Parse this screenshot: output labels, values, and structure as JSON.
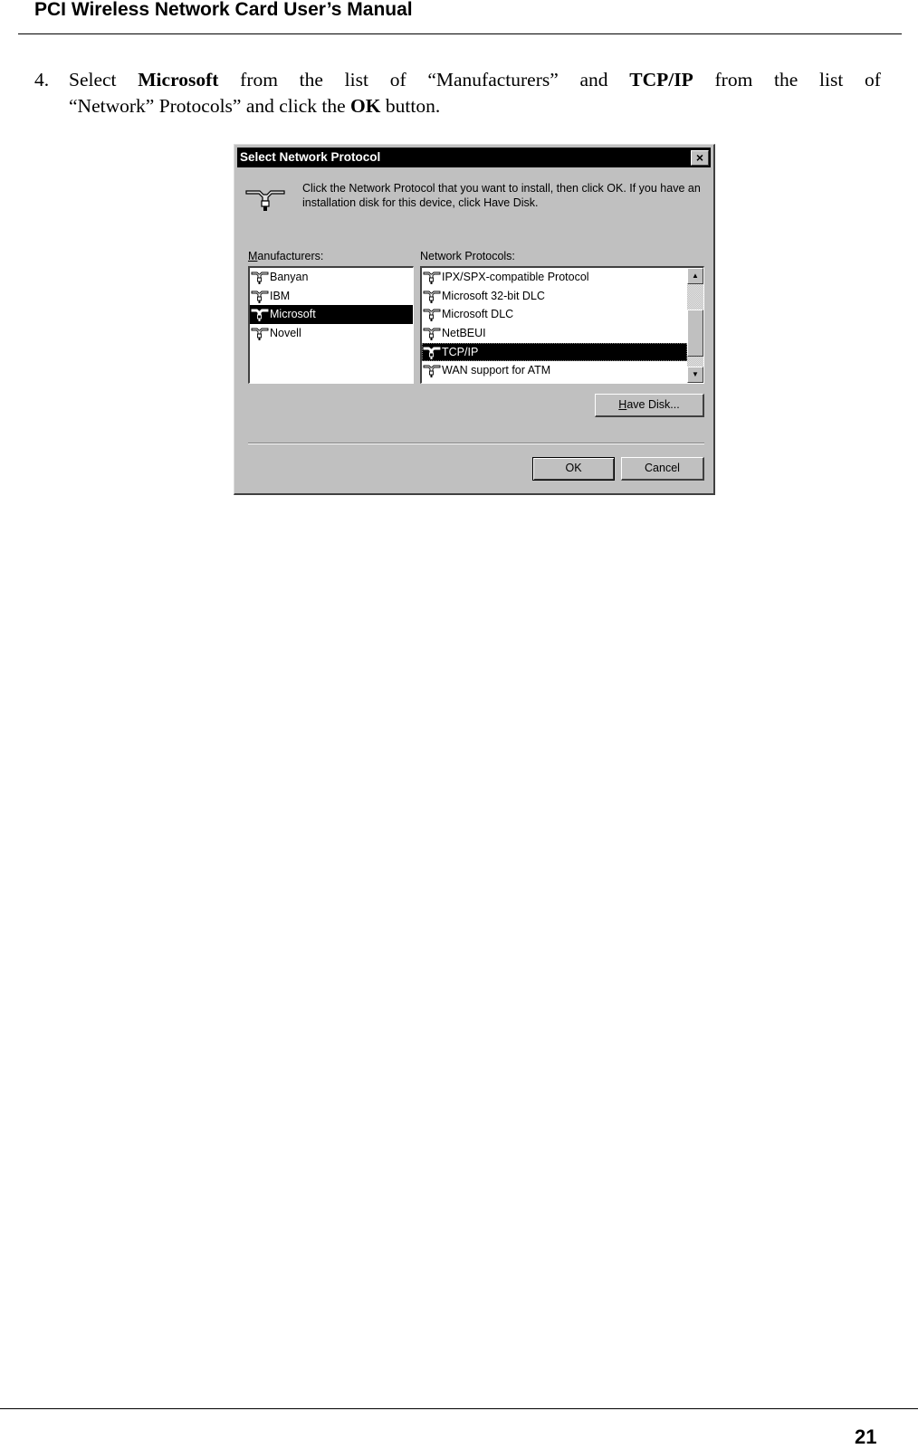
{
  "header": {
    "title": "PCI Wireless Network Card User’s Manual"
  },
  "step": {
    "number": "4.",
    "line1_parts": [
      "Select ",
      "Microsoft",
      " from the list of “Manufacturers” and ",
      "TCP/IP",
      " from the list of"
    ],
    "line2_parts": [
      "“Network” Protocols” and click the ",
      "OK",
      " button."
    ]
  },
  "dialog": {
    "title": "Select Network Protocol",
    "close_label": "×",
    "description": "Click the Network Protocol that you want to install, then click OK. If you have an installation disk for this device, click Have Disk.",
    "manufacturers_label_accel": "M",
    "manufacturers_label_rest": "anufacturers:",
    "protocols_label": "Network Protocols:",
    "manufacturers": [
      {
        "label": "Banyan",
        "selected": false
      },
      {
        "label": "IBM",
        "selected": false
      },
      {
        "label": "Microsoft",
        "selected": true
      },
      {
        "label": "Novell",
        "selected": false
      }
    ],
    "protocols": [
      {
        "label": "IPX/SPX-compatible Protocol",
        "selected": false
      },
      {
        "label": "Microsoft 32-bit DLC",
        "selected": false
      },
      {
        "label": "Microsoft DLC",
        "selected": false
      },
      {
        "label": "NetBEUI",
        "selected": false
      },
      {
        "label": "TCP/IP",
        "selected": true
      },
      {
        "label": "WAN support for ATM",
        "selected": false
      }
    ],
    "scroll_up": "▲",
    "scroll_down": "▼",
    "have_disk_accel": "H",
    "have_disk_rest": "ave Disk...",
    "ok_label": "OK",
    "cancel_label": "Cancel",
    "icon": "network-protocol-icon"
  },
  "footer": {
    "page_number": "21"
  }
}
